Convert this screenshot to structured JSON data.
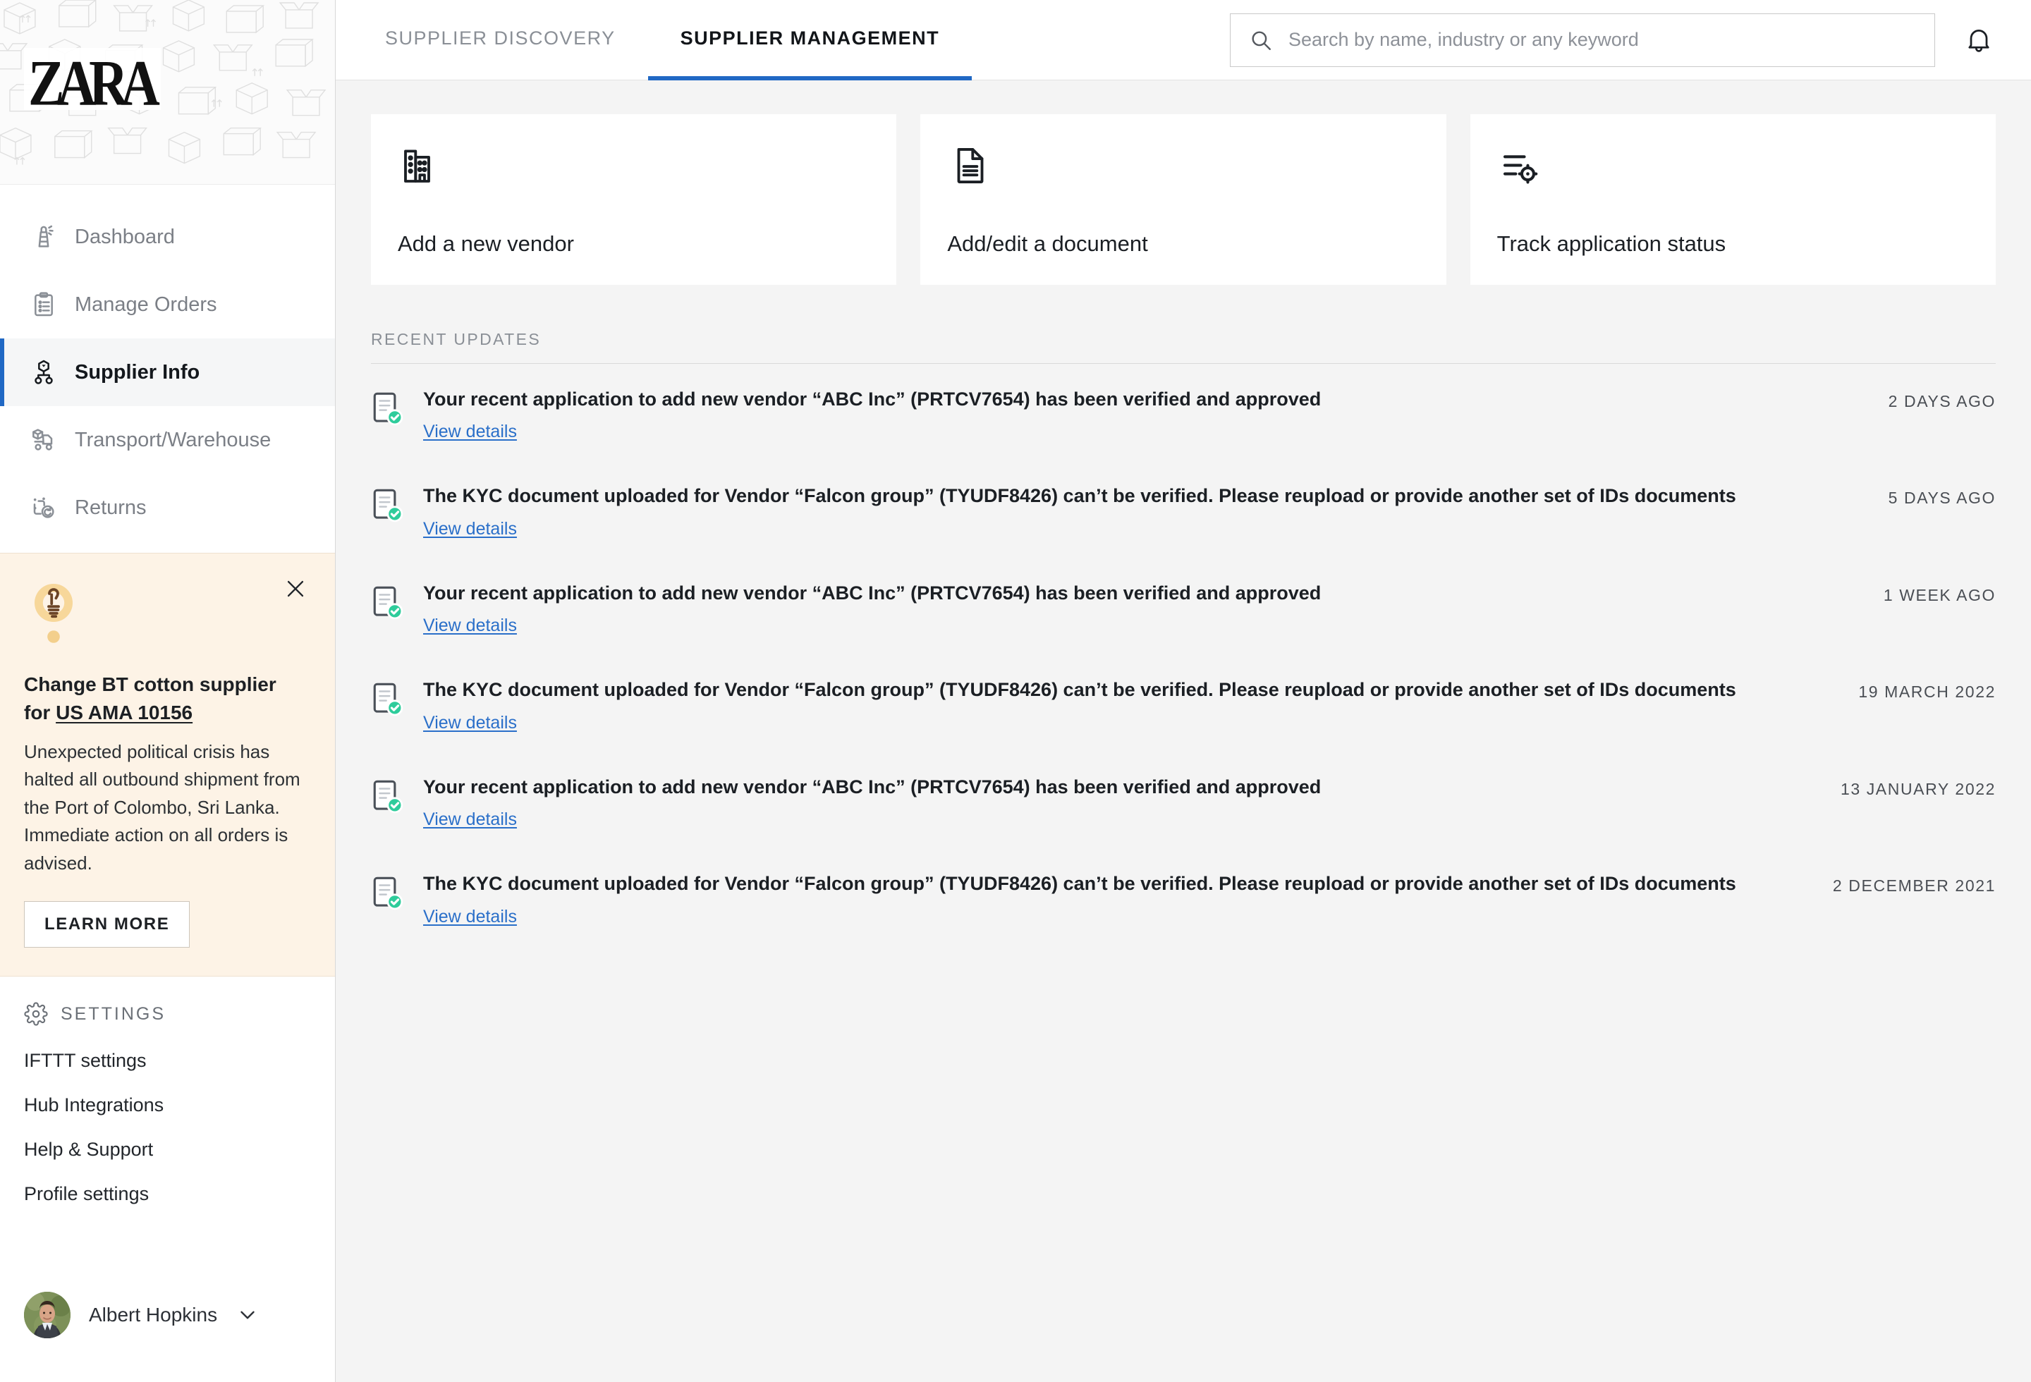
{
  "brand": {
    "logo_text": "ZARA",
    "pattern_icon": "cardboard-box-pattern"
  },
  "sidebar": {
    "items": [
      {
        "label": "Dashboard",
        "icon": "lighthouse-icon",
        "active": false
      },
      {
        "label": "Manage Orders",
        "icon": "clipboard-list-icon",
        "active": false
      },
      {
        "label": "Supplier Info",
        "icon": "supplier-network-icon",
        "active": true
      },
      {
        "label": "Transport/Warehouse",
        "icon": "delivery-truck-icon",
        "active": false
      },
      {
        "label": "Returns",
        "icon": "return-arrow-icon",
        "active": false
      }
    ],
    "tip": {
      "icon": "lightbulb-icon",
      "close_icon": "close-icon",
      "title_lead": "Change BT cotton supplier for ",
      "title_link": "US AMA 10156",
      "body": "Unexpected political crisis has halted all outbound shipment from the Port of Colombo, Sri Lanka. Immediate action on all orders is advised.",
      "button_label": "LEARN MORE"
    },
    "settings": {
      "heading": "SETTINGS",
      "icon": "gear-icon",
      "links": [
        "IFTTT settings",
        "Hub Integrations",
        "Help & Support",
        "Profile settings"
      ]
    },
    "user": {
      "name": "Albert Hopkins",
      "avatar": "user-avatar",
      "chevron": "chevron-down-icon"
    }
  },
  "topbar": {
    "tabs": [
      {
        "label": "SUPPLIER DISCOVERY",
        "active": false
      },
      {
        "label": "SUPPLIER MANAGEMENT",
        "active": true
      }
    ],
    "search": {
      "placeholder": "Search by name, industry or any keyword",
      "value": "",
      "icon": "search-icon"
    },
    "notifications_icon": "bell-icon"
  },
  "main": {
    "cards": [
      {
        "label": "Add a new vendor",
        "icon": "office-building-icon"
      },
      {
        "label": "Add/edit a document",
        "icon": "document-icon"
      },
      {
        "label": "Track application status",
        "icon": "track-status-icon"
      }
    ],
    "section_title": "RECENT UPDATES",
    "link_label": "View details",
    "row_icon": "document-verified-icon",
    "updates": [
      {
        "text": "Your recent application to add new vendor “ABC Inc” (PRTCV7654) has been verified and approved",
        "time": "2 DAYS AGO"
      },
      {
        "text": "The KYC document uploaded for Vendor “Falcon group” (TYUDF8426) can’t be verified. Please reupload or provide another set of IDs documents",
        "time": "5 DAYS AGO"
      },
      {
        "text": "Your recent application to add new vendor “ABC Inc” (PRTCV7654) has been verified and approved",
        "time": "1 WEEK AGO"
      },
      {
        "text": "The KYC document uploaded for Vendor “Falcon group” (TYUDF8426) can’t be verified. Please reupload or provide another set of IDs documents",
        "time": "19 MARCH 2022"
      },
      {
        "text": "Your recent application to add new vendor “ABC Inc” (PRTCV7654) has been verified and approved",
        "time": "13 JANUARY 2022"
      },
      {
        "text": "The KYC document uploaded for Vendor “Falcon group” (TYUDF8426) can’t be verified. Please reupload or provide another set of IDs documents",
        "time": "2 DECEMBER 2021"
      }
    ]
  },
  "colors": {
    "accent_blue": "#2068c4",
    "link_blue": "#2a6fc9",
    "tip_bg": "#fdf3e6",
    "badge_green": "#2ecc9b",
    "page_bg": "#f4f4f4"
  }
}
